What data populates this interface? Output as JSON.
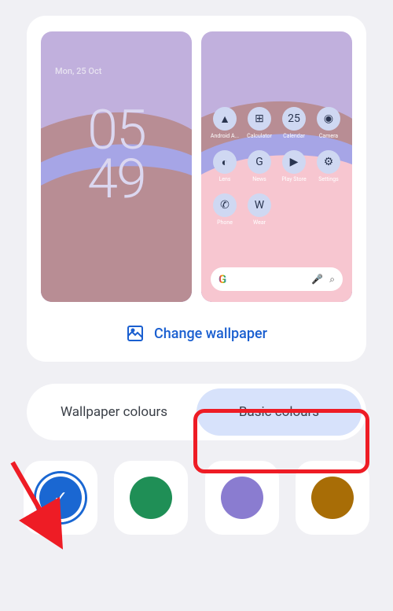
{
  "lockscreen": {
    "date": "Mon, 25 Oct",
    "time_top": "05",
    "time_bottom": "49"
  },
  "homescreen": {
    "apps": [
      {
        "label": "Android A...",
        "glyph": "▲"
      },
      {
        "label": "Calculator",
        "glyph": "⊞"
      },
      {
        "label": "Calendar",
        "glyph": "25"
      },
      {
        "label": "Camera",
        "glyph": "◉"
      },
      {
        "label": "Lens",
        "glyph": "◐"
      },
      {
        "label": "News",
        "glyph": "G"
      },
      {
        "label": "Play Store",
        "glyph": "▶"
      },
      {
        "label": "Settings",
        "glyph": "⚙"
      },
      {
        "label": "Phone",
        "glyph": "✆"
      },
      {
        "label": "Wear",
        "glyph": "W"
      },
      {
        "label": "",
        "glyph": ""
      },
      {
        "label": "",
        "glyph": ""
      }
    ],
    "search_letter": "G"
  },
  "change_wallpaper": "Change wallpaper",
  "tabs": {
    "wallpaper": "Wallpaper colours",
    "basic": "Basic colours",
    "active": "basic"
  },
  "colors": [
    {
      "hex": "#1a67d2",
      "selected": true
    },
    {
      "hex": "#1f8f56",
      "selected": false
    },
    {
      "hex": "#8a7cd0",
      "selected": false
    },
    {
      "hex": "#a86d06",
      "selected": false
    }
  ],
  "annotation": {
    "highlight_tab": "basic",
    "arrow_target": "color-0"
  }
}
